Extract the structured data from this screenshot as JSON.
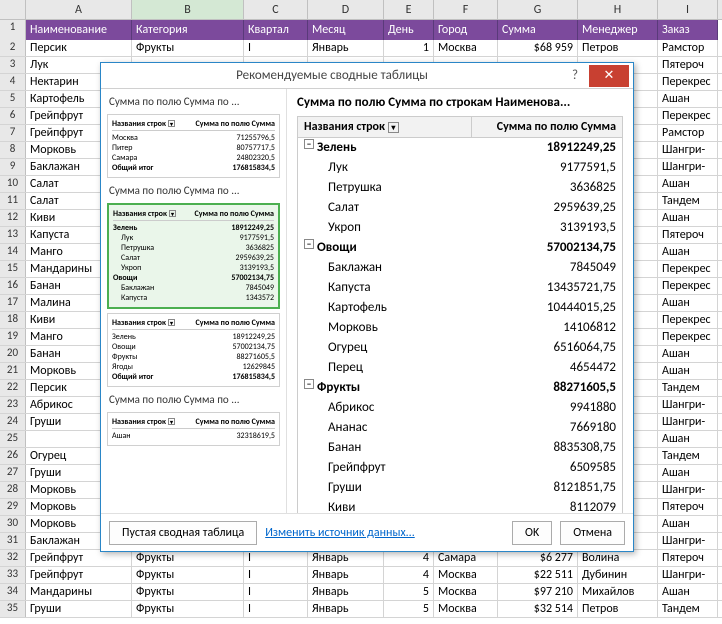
{
  "col_letters": [
    "A",
    "B",
    "C",
    "D",
    "E",
    "F",
    "G",
    "H",
    "I"
  ],
  "headers": [
    "Наименование",
    "Категория",
    "Квартал",
    "Месяц",
    "День",
    "Город",
    "Сумма",
    "Менеджер",
    "Заказ"
  ],
  "rows": [
    {
      "n": 2,
      "a": "Персик",
      "b": "Фрукты",
      "c": "I",
      "d": "Январь",
      "e": "1",
      "f": "Москва",
      "g": "$68 959",
      "h": "Петров",
      "i": "Рамстор"
    },
    {
      "n": 3,
      "a": "Лук",
      "b": "",
      "c": "",
      "d": "",
      "e": "",
      "f": "",
      "g": "",
      "h": "",
      "i": "Пятероч"
    },
    {
      "n": 4,
      "a": "Нектарин",
      "b": "",
      "c": "",
      "d": "",
      "e": "",
      "f": "",
      "g": "",
      "h": "",
      "i": "Перекрес"
    },
    {
      "n": 5,
      "a": "Картофель",
      "b": "",
      "c": "",
      "d": "",
      "e": "",
      "f": "",
      "g": "",
      "h": "",
      "i": "Ашан"
    },
    {
      "n": 6,
      "a": "Грейпфрут",
      "b": "",
      "c": "",
      "d": "",
      "e": "",
      "f": "",
      "g": "",
      "h": "",
      "i": "Перекрес"
    },
    {
      "n": 7,
      "a": "Грейпфрут",
      "b": "",
      "c": "",
      "d": "",
      "e": "",
      "f": "",
      "g": "",
      "h": "",
      "i": "Рамстор"
    },
    {
      "n": 8,
      "a": "Морковь",
      "b": "",
      "c": "",
      "d": "",
      "e": "",
      "f": "",
      "g": "",
      "h": "",
      "i": "Шангри-"
    },
    {
      "n": 9,
      "a": "Баклажан",
      "b": "",
      "c": "",
      "d": "",
      "e": "",
      "f": "",
      "g": "",
      "h": "",
      "i": "Шангри-"
    },
    {
      "n": 10,
      "a": "Салат",
      "b": "",
      "c": "",
      "d": "",
      "e": "",
      "f": "",
      "g": "",
      "h": "",
      "i": "Ашан"
    },
    {
      "n": 11,
      "a": "Салат",
      "b": "",
      "c": "",
      "d": "",
      "e": "",
      "f": "",
      "g": "",
      "h": "",
      "i": "Тандем"
    },
    {
      "n": 12,
      "a": "Киви",
      "b": "",
      "c": "",
      "d": "",
      "e": "",
      "f": "",
      "g": "",
      "h": "",
      "i": "Ашан"
    },
    {
      "n": 13,
      "a": "Капуста",
      "b": "",
      "c": "",
      "d": "",
      "e": "",
      "f": "",
      "g": "",
      "h": "",
      "i": "Пятероч"
    },
    {
      "n": 14,
      "a": "Манго",
      "b": "",
      "c": "",
      "d": "",
      "e": "",
      "f": "",
      "g": "",
      "h": "",
      "i": "Ашан"
    },
    {
      "n": 15,
      "a": "Мандарины",
      "b": "",
      "c": "",
      "d": "",
      "e": "",
      "f": "",
      "g": "",
      "h": "",
      "i": "Перекрес"
    },
    {
      "n": 16,
      "a": "Банан",
      "b": "",
      "c": "",
      "d": "",
      "e": "",
      "f": "",
      "g": "",
      "h": "",
      "i": "Перекрес"
    },
    {
      "n": 17,
      "a": "Малина",
      "b": "",
      "c": "",
      "d": "",
      "e": "",
      "f": "",
      "g": "",
      "h": "",
      "i": "Ашан"
    },
    {
      "n": 18,
      "a": "Киви",
      "b": "",
      "c": "",
      "d": "",
      "e": "",
      "f": "",
      "g": "",
      "h": "",
      "i": "Перекрес"
    },
    {
      "n": 19,
      "a": "Манго",
      "b": "",
      "c": "",
      "d": "",
      "e": "",
      "f": "",
      "g": "",
      "h": "",
      "i": "Перекрес"
    },
    {
      "n": 20,
      "a": "Банан",
      "b": "",
      "c": "",
      "d": "",
      "e": "",
      "f": "",
      "g": "",
      "h": "",
      "i": "Ашан"
    },
    {
      "n": 21,
      "a": "Морковь",
      "b": "",
      "c": "",
      "d": "",
      "e": "",
      "f": "",
      "g": "",
      "h": "",
      "i": "Ашан"
    },
    {
      "n": 22,
      "a": "Персик",
      "b": "",
      "c": "",
      "d": "",
      "e": "",
      "f": "",
      "g": "",
      "h": "",
      "i": "Тандем"
    },
    {
      "n": 23,
      "a": "Абрикос",
      "b": "",
      "c": "",
      "d": "",
      "e": "",
      "f": "",
      "g": "",
      "h": "",
      "i": "Шангри-"
    },
    {
      "n": 24,
      "a": "Груши",
      "b": "",
      "c": "",
      "d": "",
      "e": "",
      "f": "",
      "g": "",
      "h": "",
      "i": "Шангри-"
    },
    {
      "n": 25,
      "a": "",
      "b": "",
      "c": "",
      "d": "",
      "e": "",
      "f": "",
      "g": "",
      "h": "",
      "i": "Ашан"
    },
    {
      "n": 26,
      "a": "Огурец",
      "b": "",
      "c": "",
      "d": "",
      "e": "",
      "f": "",
      "g": "",
      "h": "",
      "i": "Тандем"
    },
    {
      "n": 27,
      "a": "Груши",
      "b": "",
      "c": "",
      "d": "",
      "e": "",
      "f": "",
      "g": "",
      "h": "",
      "i": "Ашан"
    },
    {
      "n": 28,
      "a": "Морковь",
      "b": "",
      "c": "",
      "d": "",
      "e": "",
      "f": "",
      "g": "",
      "h": "",
      "i": "Шангри-"
    },
    {
      "n": 29,
      "a": "Морковь",
      "b": "",
      "c": "",
      "d": "",
      "e": "",
      "f": "",
      "g": "",
      "h": "",
      "i": "Пятероч"
    },
    {
      "n": 30,
      "a": "Морковь",
      "b": "",
      "c": "",
      "d": "",
      "e": "",
      "f": "",
      "g": "",
      "h": "",
      "i": "Ашан"
    },
    {
      "n": 31,
      "a": "Баклажан",
      "b": "",
      "c": "",
      "d": "",
      "e": "",
      "f": "",
      "g": "",
      "h": "",
      "i": "Шангри-"
    },
    {
      "n": 32,
      "a": "Грейпфрут",
      "b": "Фрукты",
      "c": "I",
      "d": "Январь",
      "e": "4",
      "f": "Самара",
      "g": "$6 277",
      "h": "Волина",
      "i": "Пятероч"
    },
    {
      "n": 33,
      "a": "Грейпфрут",
      "b": "Фрукты",
      "c": "I",
      "d": "Январь",
      "e": "4",
      "f": "Москва",
      "g": "$22 511",
      "h": "Дубинин",
      "i": "Шангри-"
    },
    {
      "n": 34,
      "a": "Мандарины",
      "b": "Фрукты",
      "c": "I",
      "d": "Январь",
      "e": "5",
      "f": "Москва",
      "g": "$97 210",
      "h": "Михайлов",
      "i": "Ашан"
    },
    {
      "n": 35,
      "a": "Груши",
      "b": "Фрукты",
      "c": "I",
      "d": "Январь",
      "e": "5",
      "f": "Москва",
      "g": "$32 514",
      "h": "Петров",
      "i": "Тандем"
    }
  ],
  "dialog": {
    "title": "Рекомендуемые сводные таблицы",
    "left_title": "Сумма по полю Сумма по ...",
    "thumb1": {
      "hdr_l": "Названия строк",
      "hdr_r": "Сумма по полю Сумма",
      "rows": [
        [
          "Москва",
          "71255796,5"
        ],
        [
          "Питер",
          "80757717,5"
        ],
        [
          "Самара",
          "24802320,5"
        ]
      ],
      "total_l": "Общий итог",
      "total_r": "176815834,5"
    },
    "thumb2_title": "Сумма по полю Сумма по ...",
    "thumb2": {
      "hdr_l": "Названия строк",
      "hdr_r": "Сумма по полю Сумма",
      "rows": [
        {
          "l": "Зелень",
          "r": "18912249,25",
          "b": true
        },
        {
          "l": "Лук",
          "r": "9177591,5"
        },
        {
          "l": "Петрушка",
          "r": "3636825"
        },
        {
          "l": "Салат",
          "r": "2959639,25"
        },
        {
          "l": "Укроп",
          "r": "3139193,5"
        },
        {
          "l": "Овощи",
          "r": "57002134,75",
          "b": true
        },
        {
          "l": "Баклажан",
          "r": "7845049"
        },
        {
          "l": "Капуста",
          "r": "1343572"
        }
      ]
    },
    "thumb3": {
      "hdr_l": "Названия строк",
      "hdr_r": "Сумма по полю Сумма",
      "rows": [
        [
          "Зелень",
          "18912249,25"
        ],
        [
          "Овощи",
          "57002134,75"
        ],
        [
          "Фрукты",
          "88271605,5"
        ],
        [
          "Ягоды",
          "12629845"
        ]
      ],
      "total_l": "Общий итог",
      "total_r": "176815834,5"
    },
    "thumb4_title": "Сумма по полю Сумма по ...",
    "thumb4": {
      "hdr_l": "Названия строк",
      "hdr_r": "Сумма по полю Сумма",
      "rows": [
        [
          "Ашан",
          "32318619,5"
        ]
      ]
    },
    "preview_title": "Сумма по полю Сумма по строкам Наименова...",
    "preview_hdr_l": "Названия строк",
    "preview_hdr_r": "Сумма по полю Сумма",
    "preview": [
      {
        "t": "g",
        "l": "Зелень",
        "r": "18912249,25"
      },
      {
        "t": "c",
        "l": "Лук",
        "r": "9177591,5"
      },
      {
        "t": "c",
        "l": "Петрушка",
        "r": "3636825"
      },
      {
        "t": "c",
        "l": "Салат",
        "r": "2959639,25"
      },
      {
        "t": "c",
        "l": "Укроп",
        "r": "3139193,5"
      },
      {
        "t": "g",
        "l": "Овощи",
        "r": "57002134,75"
      },
      {
        "t": "c",
        "l": "Баклажан",
        "r": "7845049"
      },
      {
        "t": "c",
        "l": "Капуста",
        "r": "13435721,75"
      },
      {
        "t": "c",
        "l": "Картофель",
        "r": "10444015,25"
      },
      {
        "t": "c",
        "l": "Морковь",
        "r": "14106812"
      },
      {
        "t": "c",
        "l": "Огурец",
        "r": "6516064,75"
      },
      {
        "t": "c",
        "l": "Перец",
        "r": "4654472"
      },
      {
        "t": "g",
        "l": "Фрукты",
        "r": "88271605,5"
      },
      {
        "t": "c",
        "l": "Абрикос",
        "r": "9941880"
      },
      {
        "t": "c",
        "l": "Ананас",
        "r": "7669180"
      },
      {
        "t": "c",
        "l": "Банан",
        "r": "8835308,75"
      },
      {
        "t": "c",
        "l": "Грейпфрут",
        "r": "6509585"
      },
      {
        "t": "c",
        "l": "Груши",
        "r": "8121851,75"
      },
      {
        "t": "c",
        "l": "Киви",
        "r": "8112079"
      }
    ],
    "btn_blank": "Пустая сводная таблица",
    "link_source": "Изменить источник данных...",
    "btn_ok": "OK",
    "btn_cancel": "Отмена"
  }
}
